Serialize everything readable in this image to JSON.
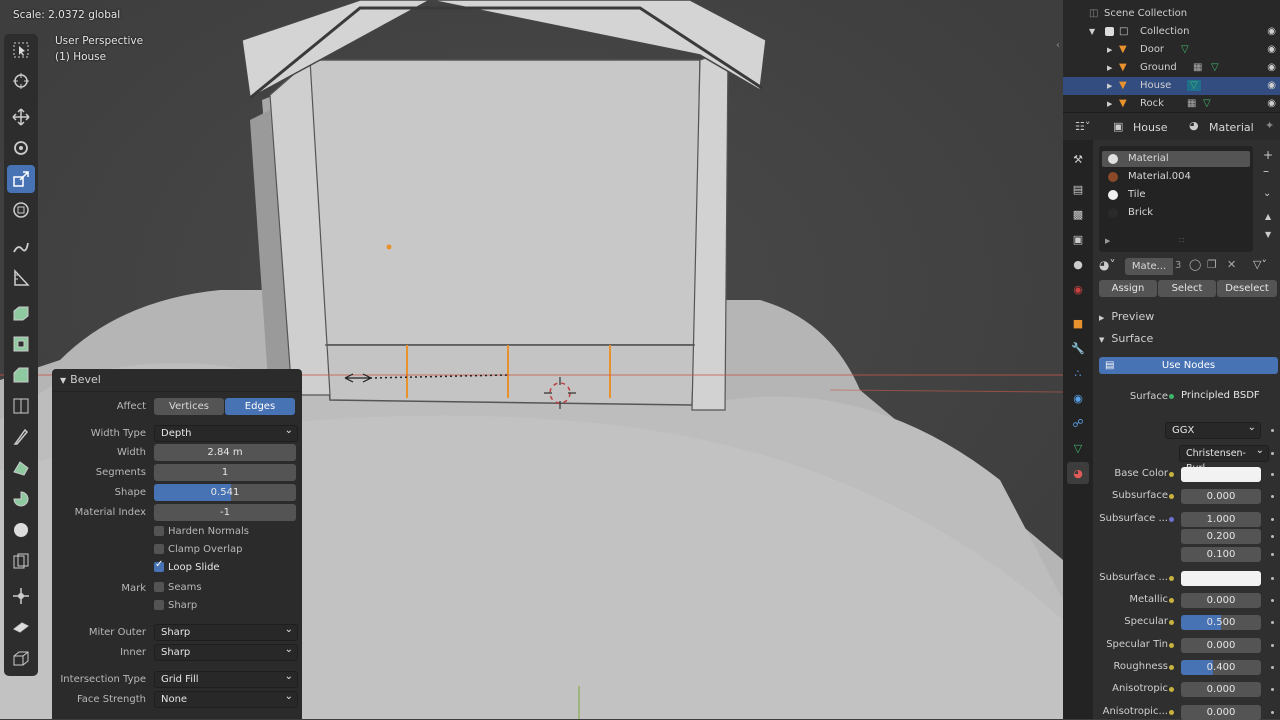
{
  "viewport": {
    "scale_text": "Scale: 2.0372 global",
    "view_name": "User Perspective",
    "object_label": "(1) House"
  },
  "toolbar": {
    "tools": [
      "select-box",
      "cursor",
      "move",
      "rotate",
      "scale",
      "transform",
      "annotate",
      "measure",
      "extrude",
      "inset",
      "bevel",
      "loop-cut",
      "knife",
      "poly-build",
      "spin",
      "smooth",
      "shrink-fatten",
      "shear",
      "rip"
    ],
    "active": "scale"
  },
  "bevel": {
    "title": "Bevel",
    "affect_label": "Affect",
    "affect_options": [
      "Vertices",
      "Edges"
    ],
    "affect_selected": "Edges",
    "width_type_label": "Width Type",
    "width_type_value": "Depth",
    "width_label": "Width",
    "width_value": "2.84 m",
    "segments_label": "Segments",
    "segments_value": "1",
    "shape_label": "Shape",
    "shape_value": "0.541",
    "shape_fraction": 0.541,
    "material_index_label": "Material Index",
    "material_index_value": "-1",
    "harden_normals": "Harden Normals",
    "clamp_overlap": "Clamp Overlap",
    "loop_slide": "Loop Slide",
    "mark_label": "Mark",
    "seams": "Seams",
    "sharp": "Sharp",
    "miter_outer_label": "Miter Outer",
    "miter_outer_value": "Sharp",
    "inner_label": "Inner",
    "inner_value": "Sharp",
    "intersection_type_label": "Intersection Type",
    "intersection_type_value": "Grid Fill",
    "face_strength_label": "Face Strength",
    "face_strength_value": "None"
  },
  "outliner": {
    "scene_collection": "Scene Collection",
    "collection": "Collection",
    "items": [
      {
        "name": "Door",
        "selected": false
      },
      {
        "name": "Ground",
        "selected": false
      },
      {
        "name": "House",
        "selected": true
      },
      {
        "name": "Rock",
        "selected": false
      }
    ]
  },
  "properties": {
    "object_name": "House",
    "material_tab": "Material",
    "materials": [
      {
        "name": "Material",
        "color": "#e0e0e0"
      },
      {
        "name": "Material.004",
        "color": "#8a4a2a"
      },
      {
        "name": "Tile",
        "color": "#f0f0f0"
      },
      {
        "name": "Brick",
        "color": "#2a2a2a"
      }
    ],
    "slot_name": "Mate...",
    "slot_users": "3",
    "assign": "Assign",
    "select": "Select",
    "deselect": "Deselect",
    "preview": "Preview",
    "surface_section": "Surface",
    "use_nodes": "Use Nodes",
    "surface_label": "Surface",
    "surface_value": "Principled BSDF",
    "distribution": "GGX",
    "subsurface_method": "Christensen-Burl...",
    "rows": [
      {
        "label": "Base Color",
        "value": "",
        "color": "#f2f2f2"
      },
      {
        "label": "Subsurface",
        "value": "0.000"
      },
      {
        "label": "Subsurface ...",
        "value": "1.000"
      },
      {
        "label": "",
        "value": "0.200"
      },
      {
        "label": "",
        "value": "0.100"
      },
      {
        "label": "Subsurface ...",
        "value": "",
        "color": "#f2f2f2"
      },
      {
        "label": "Metallic",
        "value": "0.000"
      },
      {
        "label": "Specular",
        "value": "0.500",
        "fill": 0.5
      },
      {
        "label": "Specular Tin",
        "value": "0.000"
      },
      {
        "label": "Roughness",
        "value": "0.400",
        "fill": 0.4
      },
      {
        "label": "Anisotropic",
        "value": "0.000"
      },
      {
        "label": "Anisotropic...",
        "value": "0.000"
      }
    ]
  },
  "colors": {
    "accent": "#4772b3",
    "selected_row": "#334d80",
    "edge_highlight": "#e8922e",
    "object_icon": "#e8922e",
    "mesh_icon": "#3fb56b"
  }
}
